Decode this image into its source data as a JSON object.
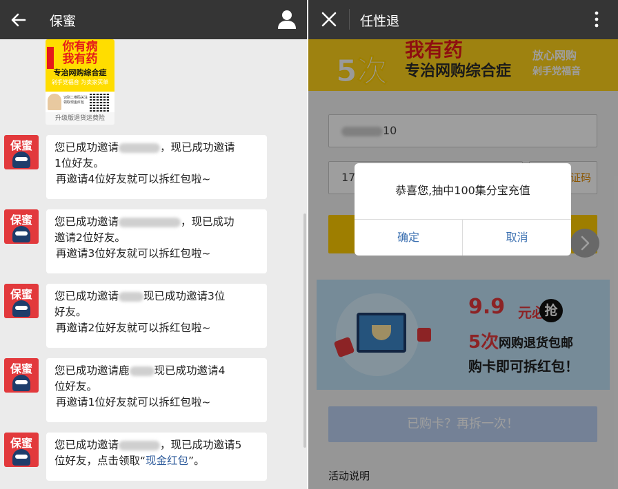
{
  "chat": {
    "back_icon": "arrow-left-icon",
    "title": "保蜜",
    "profile_icon": "person-icon",
    "poster": {
      "headline_line1": "你有病",
      "headline_line2": "我有药",
      "subtitle": "专治网购综合症",
      "tagline": "剁手党福音  为卖家买单",
      "qr_caption": "识别二维码关注 领取现金红包",
      "footer": "升级版退货运费险"
    },
    "avatar_label": "保蜜",
    "messages": [
      {
        "part1": "您已成功邀请",
        "part2": "，现已成功邀请",
        "line2": "1位好友。",
        "line3": "再邀请4位好友就可以拆红包啦~"
      },
      {
        "part1": "您已成功邀请",
        "part2": "，现已成功",
        "line2": "邀请2位好友。",
        "line3": "再邀请3位好友就可以拆红包啦~"
      },
      {
        "part1": "您已成功邀请",
        "part2": "现已成功邀请3位",
        "line2": "好友。",
        "line3": "再邀请2位好友就可以拆红包啦~"
      },
      {
        "part1": "您已成功邀请鹿",
        "part2": "现已成功邀请4",
        "line2": "位好友。",
        "line3": "再邀请1位好友就可以拆红包啦~"
      },
      {
        "part1": "您已成功邀请",
        "part2": "，现已成功邀请5",
        "line2_a": "位好友，点击领取“",
        "link": "现金红包",
        "line2_b": "”。"
      }
    ]
  },
  "page": {
    "close_icon": "close-icon",
    "title": "任性退",
    "more_icon": "more-vertical-icon",
    "banner": {
      "count": "5次",
      "headline": "我有药",
      "subtitle": "专治网购综合症",
      "right_line1": "放心网购",
      "right_line2": "剁手党福音"
    },
    "phone_value": "10",
    "code_prefix": "17",
    "code_button": "证码",
    "arrow_icon": "chevron-right-icon",
    "promo": {
      "price": "9.9",
      "price_suffix": "元必",
      "grab": "抢",
      "count": "5次",
      "count_text": "网购退货包邮",
      "cta": "购卡即可拆红包！"
    },
    "buy_again": "已购卡？再拆一次！",
    "activity_label": "活动说明"
  },
  "dialog": {
    "message": "恭喜您,抽中100集分宝充值",
    "confirm": "确定",
    "cancel": "取消"
  },
  "colors": {
    "topbar": "#353535",
    "chat_bg": "#ebebeb",
    "accent_red": "#e2393c",
    "banner_yellow": "#ffd21a",
    "dialog_button": "#3a6fb0",
    "link": "#2e5b9b"
  }
}
